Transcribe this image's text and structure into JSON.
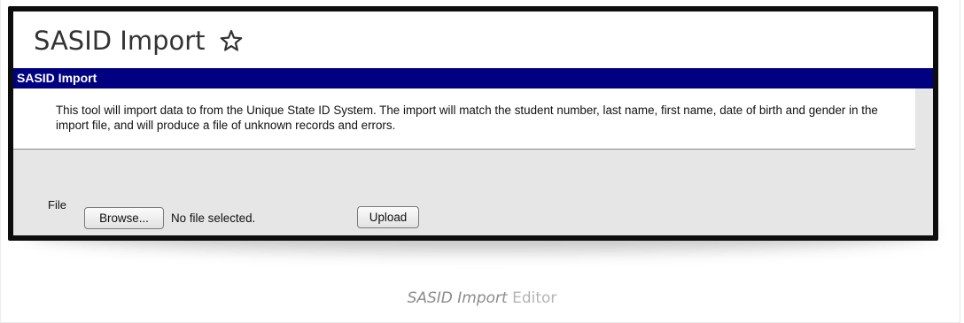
{
  "page": {
    "title": "SASID Import",
    "favorite_icon": "star-outline-icon"
  },
  "panel": {
    "header": "SASID Import",
    "description": "This tool will import data to from the Unique State ID System. The import will match the student number, last name, first name, date of birth and gender in the import file, and will produce a file of unknown records and errors."
  },
  "form": {
    "file_label": "File",
    "browse_label": "Browse...",
    "file_status": "No file selected.",
    "upload_label": "Upload"
  },
  "caption": {
    "main": "SASID Import",
    "suffix": "Editor"
  },
  "colors": {
    "header_bar": "#000080",
    "panel_background": "#e6e6e6",
    "frame_border": "#0d0d0d"
  }
}
